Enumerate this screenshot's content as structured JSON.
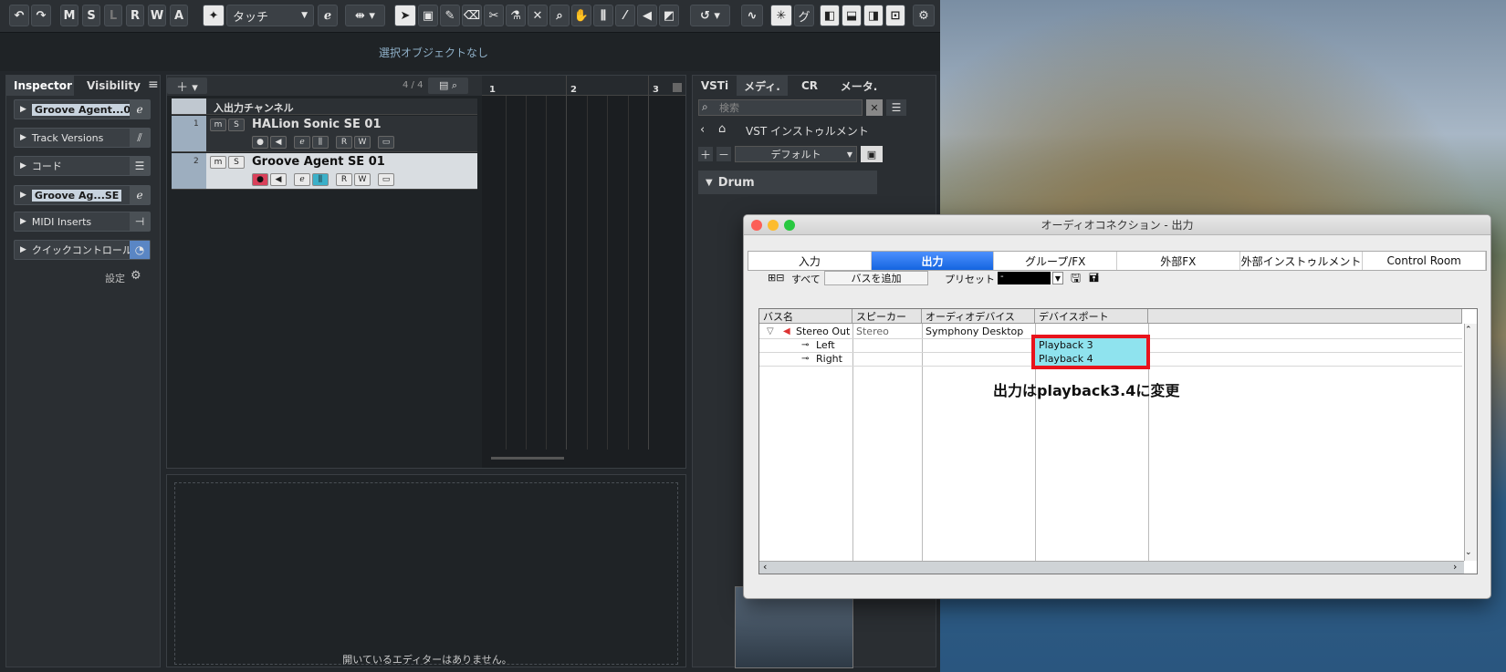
{
  "toolbar": {
    "buttons": [
      "M",
      "S",
      "L",
      "R",
      "W",
      "A"
    ],
    "automation_mode": "タッチ",
    "groove": "グ"
  },
  "status": {
    "text": "選択オブジェクトなし"
  },
  "inspector": {
    "tabs": [
      "Inspector",
      "Visibility"
    ],
    "rows": [
      {
        "label": "Groove Agent...01"
      },
      {
        "label": "Track Versions"
      },
      {
        "label": "コード"
      },
      {
        "label": "Groove Ag...SE"
      },
      {
        "label": "MIDI Inserts"
      },
      {
        "label": "クイックコントロール"
      }
    ],
    "settings": "設定"
  },
  "tracks": {
    "count": "4 / 4",
    "io_label": "入出力チャンネル",
    "items": [
      {
        "num": "1",
        "name": "HALion Sonic SE 01"
      },
      {
        "num": "2",
        "name": "Groove Agent SE 01"
      }
    ],
    "ruler": [
      "1",
      "2",
      "3"
    ]
  },
  "editor": {
    "empty": "開いているエディターはありません。"
  },
  "right": {
    "tabs": [
      "VSTi",
      "メディ.",
      "CR",
      "メータ."
    ],
    "search_placeholder": "検索",
    "breadcrumb": "VST インストゥルメント",
    "preset": "デフォルト",
    "folder": "Drum"
  },
  "dialog": {
    "title": "オーディオコネクション - 出力",
    "tabs": [
      "入力",
      "出力",
      "グループ/FX",
      "外部FX",
      "外部インストゥルメント",
      "Control Room"
    ],
    "all_label": "すべて",
    "add_bus": "バスを追加",
    "preset_label": "プリセット",
    "preset_value": "-",
    "columns": [
      "バス名",
      "スピーカー",
      "オーディオデバイス",
      "デバイスポート"
    ],
    "rows": [
      {
        "bus": "Stereo Out",
        "speaker": "Stereo",
        "device": "Symphony Desktop",
        "port": ""
      },
      {
        "bus": "Left",
        "speaker": "",
        "device": "",
        "port": "Playback 3"
      },
      {
        "bus": "Right",
        "speaker": "",
        "device": "",
        "port": "Playback 4"
      }
    ],
    "annotation": "出力はplayback3.4に変更",
    "highlight_color": "#e8141c",
    "port_bg": "#8fe3ee"
  }
}
